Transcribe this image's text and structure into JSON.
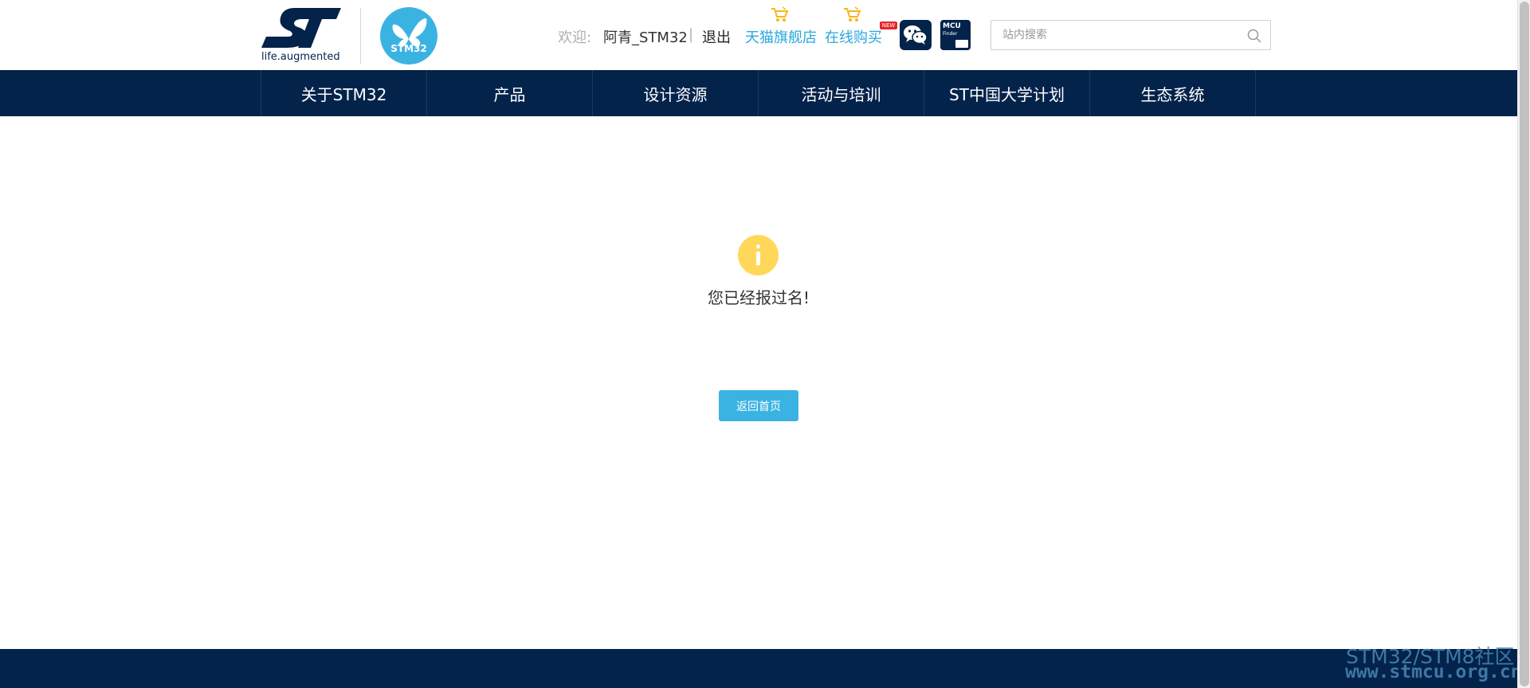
{
  "header": {
    "logo_tagline": "life.augmented",
    "stm32_logo_text": "STM32",
    "welcome_label": "欢迎:",
    "username": "阿青_STM32",
    "separator": "|",
    "logout": "退出",
    "tmall_store": "天猫旗舰店",
    "online_buy": "在线购买",
    "new_badge": "NEW",
    "mcu_icon_title": "MCU",
    "mcu_icon_sub": "Finder",
    "search": {
      "placeholder": "站内搜索",
      "value": ""
    }
  },
  "nav": {
    "items": [
      {
        "label": "关于STM32"
      },
      {
        "label": "产品"
      },
      {
        "label": "设计资源"
      },
      {
        "label": "活动与培训"
      },
      {
        "label": "ST中国大学计划"
      },
      {
        "label": "生态系统"
      }
    ]
  },
  "main": {
    "message": "您已经报过名!",
    "home_button": "返回首页"
  },
  "watermark": {
    "line1": "STM32/STM8社区",
    "line2": "www.stmcu.org.cn"
  },
  "colors": {
    "navy": "#03234b",
    "accent_blue": "#3bb3e2",
    "link_blue": "#2aa7de",
    "info_yellow": "#ffd85a"
  },
  "icons": [
    "st-logo-icon",
    "stm32-butterfly-icon",
    "cart-icon",
    "wechat-icon",
    "mcu-finder-icon",
    "search-icon",
    "info-icon"
  ]
}
